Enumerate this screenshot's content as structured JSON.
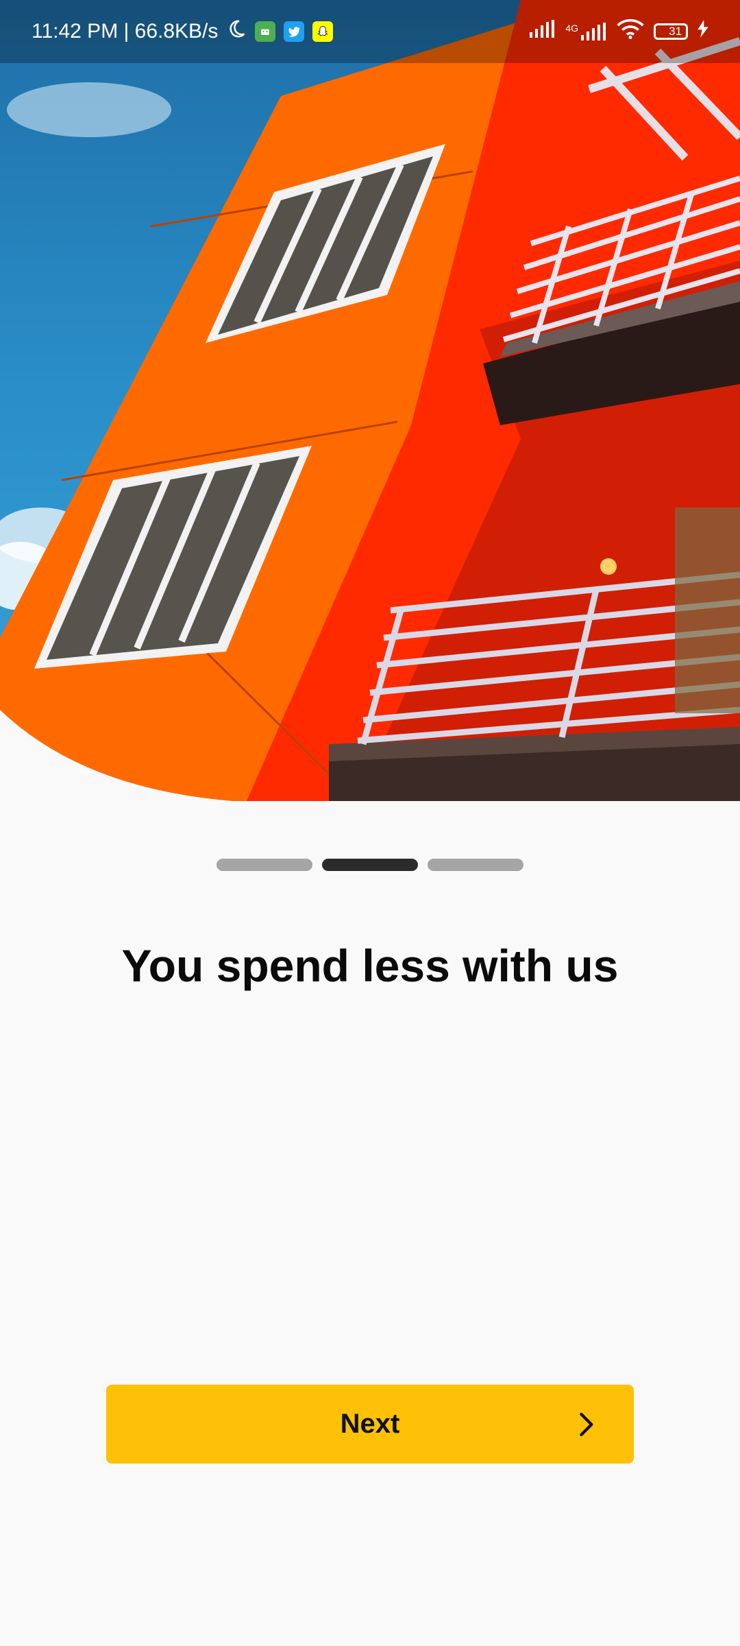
{
  "status_bar": {
    "time_speed": "11:42 PM | 66.8KB/s",
    "network_label": "4G",
    "battery_level": "31",
    "icons": [
      "moon-icon",
      "android-app-icon",
      "twitter-icon",
      "snapchat-icon",
      "signal-icon",
      "signal-4g-icon",
      "wifi-icon",
      "battery-icon",
      "charging-icon"
    ]
  },
  "onboarding": {
    "page_indicator": {
      "total": 3,
      "active_index": 1
    },
    "title": "You spend less with us",
    "next_label": "Next"
  },
  "colors": {
    "accent": "#fec107",
    "indicator_active": "#2b2b2b",
    "indicator_inactive": "#a5a5a5",
    "background": "#f9f9f9"
  }
}
